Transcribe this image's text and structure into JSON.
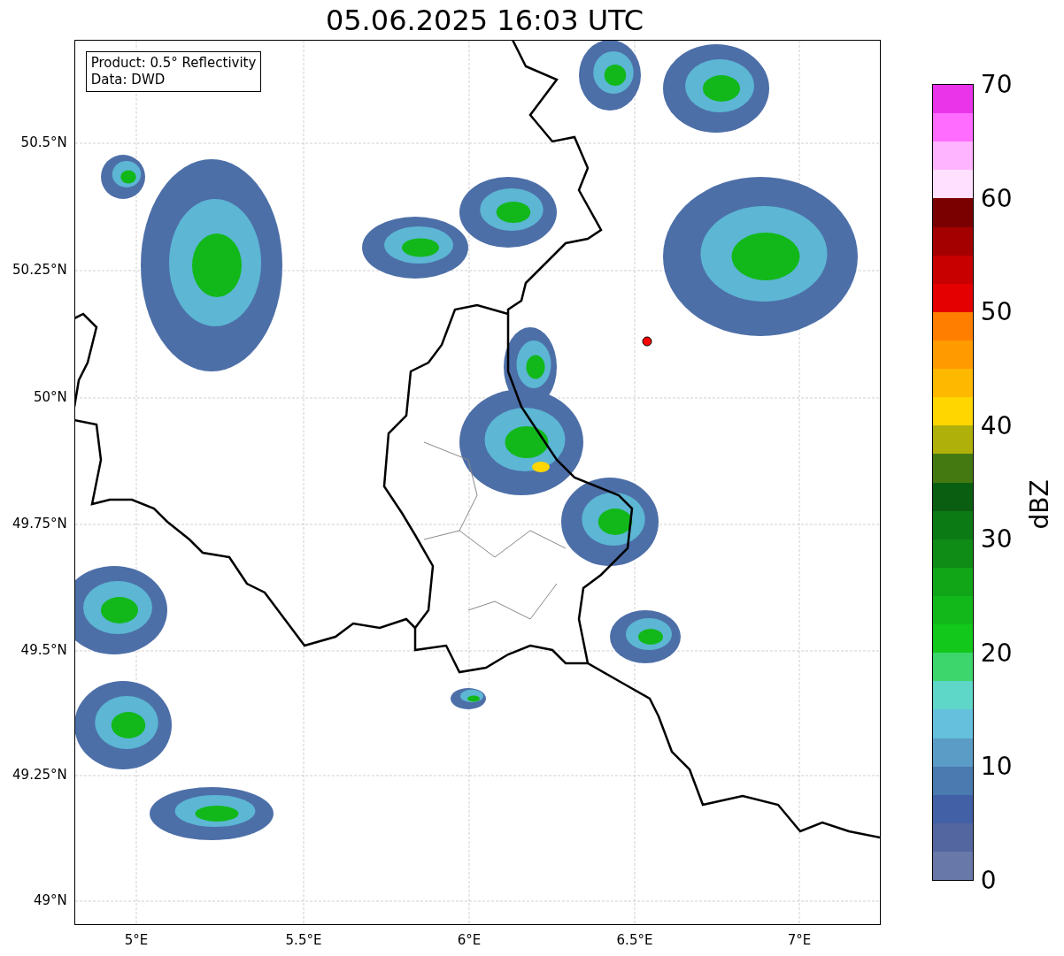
{
  "title": "05.06.2025 16:03 UTC",
  "legend": {
    "lines": [
      "Product: 0.5° Reflectivity",
      "Data: DWD"
    ]
  },
  "map": {
    "y_ticks": [
      "50.5°N",
      "50.25°N",
      "50°N",
      "49.75°N",
      "49.5°N",
      "49.25°N",
      "49°N"
    ],
    "x_ticks": [
      "5°E",
      "5.5°E",
      "6°E",
      "6.5°E",
      "7°E"
    ]
  },
  "colorbar": {
    "label": "dBZ",
    "ticks": [
      "70",
      "60",
      "50",
      "40",
      "30",
      "20",
      "10",
      "0"
    ],
    "segments": [
      {
        "color": "#ea34ea"
      },
      {
        "color": "#ff6cff"
      },
      {
        "color": "#ffb4ff"
      },
      {
        "color": "#ffe0ff"
      },
      {
        "color": "#7a0000"
      },
      {
        "color": "#a40000"
      },
      {
        "color": "#c80000"
      },
      {
        "color": "#e40000"
      },
      {
        "color": "#ff7e00"
      },
      {
        "color": "#ff9a00"
      },
      {
        "color": "#ffb800"
      },
      {
        "color": "#ffd600"
      },
      {
        "color": "#b0b00a"
      },
      {
        "color": "#447810"
      },
      {
        "color": "#0a5e12"
      },
      {
        "color": "#0c7a14"
      },
      {
        "color": "#0e8c16"
      },
      {
        "color": "#10a618"
      },
      {
        "color": "#12b81a"
      },
      {
        "color": "#12c81a"
      },
      {
        "color": "#3cd66c"
      },
      {
        "color": "#5ed6c8"
      },
      {
        "color": "#64c0dc"
      },
      {
        "color": "#5a9cc6"
      },
      {
        "color": "#4a7ab0"
      },
      {
        "color": "#4260a6"
      },
      {
        "color": "#5366a0"
      },
      {
        "color": "#6878a8"
      }
    ]
  }
}
